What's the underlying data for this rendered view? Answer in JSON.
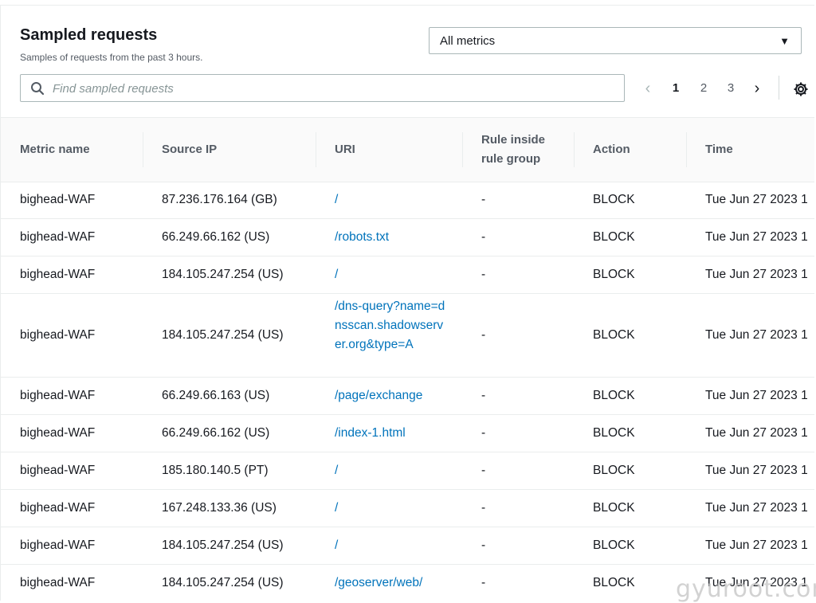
{
  "header": {
    "title": "Sampled requests",
    "subtitle": "Samples of requests from the past 3 hours."
  },
  "metric_select": {
    "value": "All metrics"
  },
  "search": {
    "placeholder": "Find sampled requests",
    "value": ""
  },
  "pagination": {
    "pages": [
      "1",
      "2",
      "3"
    ],
    "current": "1"
  },
  "table": {
    "columns": {
      "metric": "Metric name",
      "ip": "Source IP",
      "uri": "URI",
      "rule_line1": "Rule inside",
      "rule_line2": "rule group",
      "action": "Action",
      "time": "Time"
    },
    "rows": [
      {
        "metric": "bighead-WAF",
        "ip": "87.236.176.164 (GB)",
        "uri": "/",
        "rule": "-",
        "action": "BLOCK",
        "time": "Tue Jun 27 2023 1"
      },
      {
        "metric": "bighead-WAF",
        "ip": "66.249.66.162 (US)",
        "uri": "/robots.txt",
        "rule": "-",
        "action": "BLOCK",
        "time": "Tue Jun 27 2023 1"
      },
      {
        "metric": "bighead-WAF",
        "ip": "184.105.247.254 (US)",
        "uri": "/",
        "rule": "-",
        "action": "BLOCK",
        "time": "Tue Jun 27 2023 1"
      },
      {
        "metric": "bighead-WAF",
        "ip": "184.105.247.254 (US)",
        "uri": "/dns-query?name=dnsscan.shadowserver.org&type=A",
        "rule": "-",
        "action": "BLOCK",
        "time": "Tue Jun 27 2023 1"
      },
      {
        "metric": "bighead-WAF",
        "ip": "66.249.66.163 (US)",
        "uri": "/page/exchange",
        "rule": "-",
        "action": "BLOCK",
        "time": "Tue Jun 27 2023 1"
      },
      {
        "metric": "bighead-WAF",
        "ip": "66.249.66.162 (US)",
        "uri": "/index-1.html",
        "rule": "-",
        "action": "BLOCK",
        "time": "Tue Jun 27 2023 1"
      },
      {
        "metric": "bighead-WAF",
        "ip": "185.180.140.5 (PT)",
        "uri": "/",
        "rule": "-",
        "action": "BLOCK",
        "time": "Tue Jun 27 2023 1"
      },
      {
        "metric": "bighead-WAF",
        "ip": "167.248.133.36 (US)",
        "uri": "/",
        "rule": "-",
        "action": "BLOCK",
        "time": "Tue Jun 27 2023 1"
      },
      {
        "metric": "bighead-WAF",
        "ip": "184.105.247.254 (US)",
        "uri": "/",
        "rule": "-",
        "action": "BLOCK",
        "time": "Tue Jun 27 2023 1"
      },
      {
        "metric": "bighead-WAF",
        "ip": "184.105.247.254 (US)",
        "uri": "/geoserver/web/",
        "rule": "-",
        "action": "BLOCK",
        "time": "Tue Jun 27 2023 1"
      }
    ]
  },
  "watermark": "gyuroot.com",
  "icons": {
    "search": "search-icon",
    "dropdown": "caret-down-icon",
    "prev": "chevron-left-icon",
    "next": "chevron-right-icon",
    "settings": "gear-icon"
  },
  "colors": {
    "link": "#0073bb",
    "text": "#16191f",
    "muted": "#545b64",
    "border": "#aab7b8"
  }
}
